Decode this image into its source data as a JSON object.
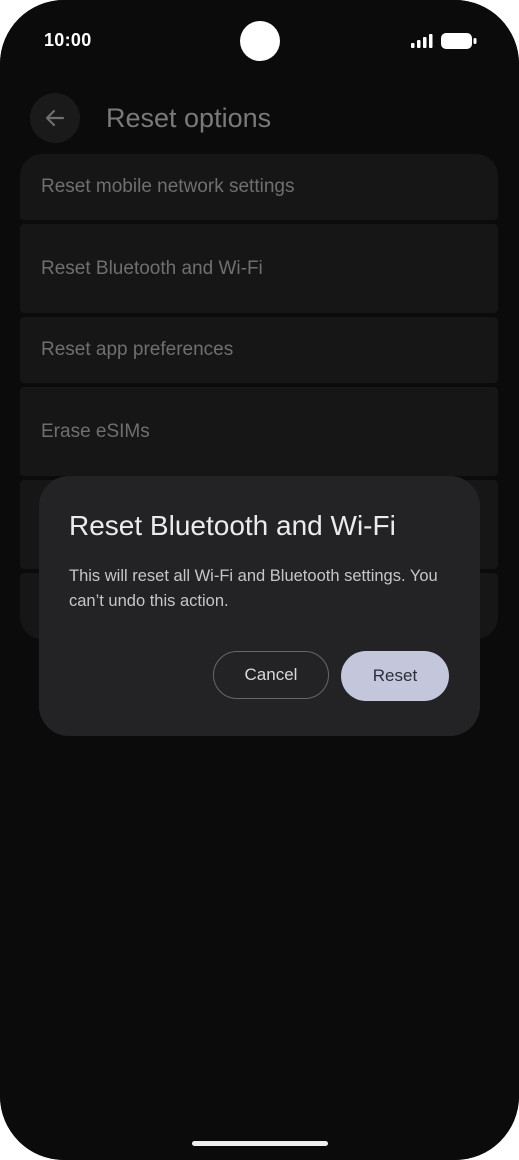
{
  "status_bar": {
    "time": "10:00",
    "signal_icon": "signal-icon",
    "battery_icon": "battery-icon"
  },
  "app_bar": {
    "back_icon": "arrow-back-icon",
    "title": "Reset options"
  },
  "options": [
    {
      "label": "Reset mobile network settings"
    },
    {
      "label": "Reset Bluetooth and Wi-Fi"
    },
    {
      "label": "Reset app preferences"
    },
    {
      "label": "Erase eSIMs"
    },
    {
      "label": ""
    },
    {
      "label": ""
    }
  ],
  "dialog": {
    "title": "Reset Bluetooth and Wi-Fi",
    "message": "This will reset all Wi-Fi and Bluetooth settings. You can’t undo this action.",
    "cancel_label": "Cancel",
    "confirm_label": "Reset"
  },
  "colors": {
    "background": "#0b0b0b",
    "dialog_surface": "#232325",
    "confirm_button": "#c4c6dc"
  }
}
